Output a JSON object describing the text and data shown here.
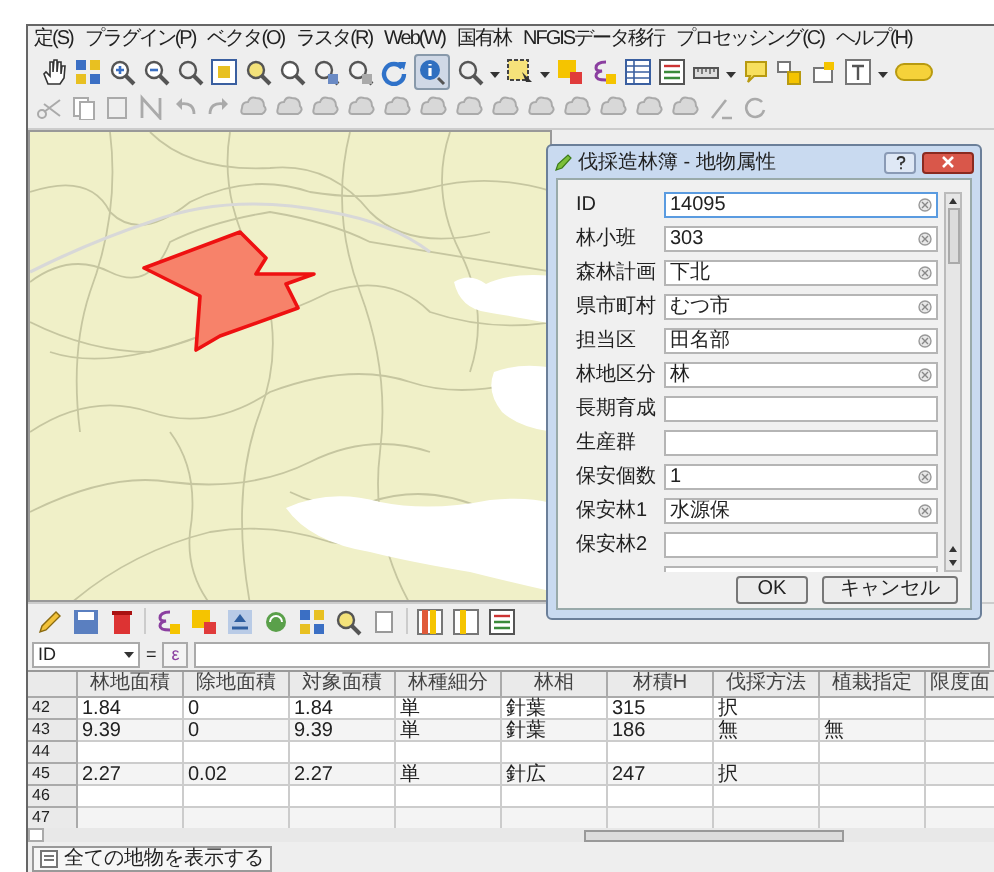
{
  "menu": [
    "定(S)",
    "プラグイン(P)",
    "ベクタ(O)",
    "ラスタ(R)",
    "Web(W)",
    "国有林",
    "NFGISデータ移行",
    "プロセッシング(C)",
    "ヘルプ(H)"
  ],
  "identify_tool": {
    "pressed": true
  },
  "dialog": {
    "title": "伐採造林簿 - 地物属性",
    "fields": [
      {
        "label": "ID",
        "value": "14095",
        "focused": true
      },
      {
        "label": "林小班",
        "value": "303",
        "focused": false
      },
      {
        "label": "森林計画",
        "value": "下北",
        "focused": false
      },
      {
        "label": "県市町村",
        "value": "むつ市",
        "focused": false
      },
      {
        "label": "担当区",
        "value": "田名部",
        "focused": false
      },
      {
        "label": "林地区分",
        "value": "林",
        "focused": false
      },
      {
        "label": "長期育成",
        "focused": false
      },
      {
        "label": "生産群",
        "focused": false
      },
      {
        "label": "保安個数",
        "value": "1",
        "focused": false
      },
      {
        "label": "保安林1",
        "value": "水源保",
        "focused": false
      },
      {
        "label": "保安林2",
        "focused": false
      }
    ],
    "buttons": [
      "OK",
      "キャンセル"
    ]
  },
  "filter": {
    "field": "ID",
    "operator": "=",
    "expression_button": "ε"
  },
  "table": {
    "columns": [
      "林地面積",
      "除地面積",
      "対象面積",
      "林種細分",
      "林相",
      "材積H",
      "伐採方法",
      "植栽指定",
      "限度面"
    ],
    "rows": [
      {
        "header": "42",
        "cells": [
          "1.84",
          "0",
          "1.84",
          "単",
          "針葉",
          "315",
          "択",
          null,
          null
        ]
      },
      {
        "header": "43",
        "cells": [
          "9.39",
          "0",
          "9.39",
          "単",
          "針葉",
          "186",
          "無",
          "無",
          null
        ]
      },
      {
        "header": "44",
        "cells": [
          null,
          null,
          null,
          null,
          null,
          null,
          null,
          null,
          null
        ]
      },
      {
        "header": "45",
        "cells": [
          "2.27",
          "0.02",
          "2.27",
          "単",
          "針広",
          "247",
          "択",
          null,
          null
        ]
      },
      {
        "header": "46",
        "cells": [
          null,
          null,
          null,
          null,
          null,
          null,
          null,
          null,
          null
        ]
      },
      {
        "header": "47",
        "cells": [
          null,
          null,
          null,
          null,
          null,
          null,
          null,
          null,
          null
        ]
      }
    ]
  },
  "show_all_button": "全ての地物を表示する"
}
